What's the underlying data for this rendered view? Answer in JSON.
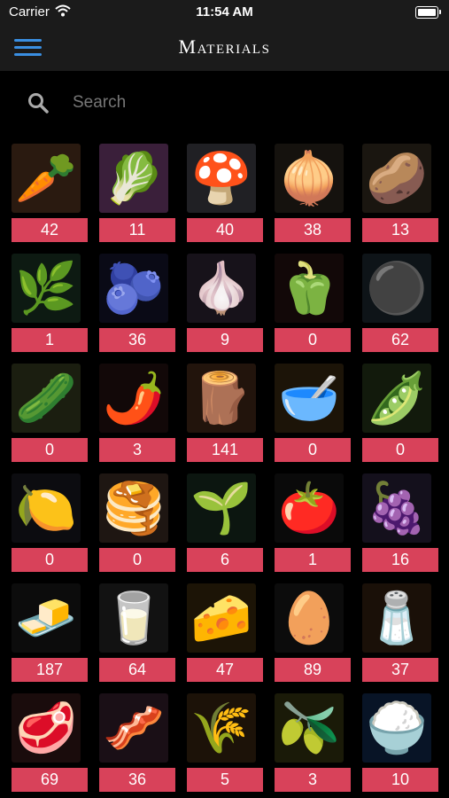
{
  "status_bar": {
    "carrier": "Carrier",
    "time": "11:54 AM"
  },
  "nav": {
    "title": "Materials"
  },
  "search": {
    "placeholder": "Search"
  },
  "materials": [
    {
      "icon": "carrot-icon",
      "glyph": "🥕",
      "bg": "#2a1a10",
      "count": "42"
    },
    {
      "icon": "lettuce-icon",
      "glyph": "🥬",
      "bg": "#3a1f3a",
      "count": "11"
    },
    {
      "icon": "mushroom-icon",
      "glyph": "🍄",
      "bg": "#202024",
      "count": "40"
    },
    {
      "icon": "onion-icon",
      "glyph": "🧅",
      "bg": "#15120e",
      "count": "38"
    },
    {
      "icon": "potato-icon",
      "glyph": "🥔",
      "bg": "#1a1610",
      "count": "13"
    },
    {
      "icon": "parsley-icon",
      "glyph": "🌿",
      "bg": "#0d1a12",
      "count": "1"
    },
    {
      "icon": "blueberries-icon",
      "glyph": "🫐",
      "bg": "#0a0a16",
      "count": "36"
    },
    {
      "icon": "garlic-icon",
      "glyph": "🧄",
      "bg": "#17121a",
      "count": "9"
    },
    {
      "icon": "bell-pepper-icon",
      "glyph": "🫑",
      "bg": "#120808",
      "count": "0"
    },
    {
      "icon": "peppercorns-icon",
      "glyph": "⚫",
      "bg": "#0e1418",
      "count": "62"
    },
    {
      "icon": "celery-icon",
      "glyph": "🥒",
      "bg": "#1b1e10",
      "count": "0"
    },
    {
      "icon": "chili-icon",
      "glyph": "🌶️",
      "bg": "#120808",
      "count": "3"
    },
    {
      "icon": "cinnamon-icon",
      "glyph": "🪵",
      "bg": "#22140c",
      "count": "141"
    },
    {
      "icon": "flour-bowl-icon",
      "glyph": "🥣",
      "bg": "#1c1408",
      "count": "0"
    },
    {
      "icon": "green-beans-icon",
      "glyph": "🫛",
      "bg": "#121a0c",
      "count": "0"
    },
    {
      "icon": "lemon-icon",
      "glyph": "🍋",
      "bg": "#0c0c10",
      "count": "0"
    },
    {
      "icon": "paprika-icon",
      "glyph": "🥞",
      "bg": "#1e1612",
      "count": "0"
    },
    {
      "icon": "basil-icon",
      "glyph": "🌱",
      "bg": "#0c1610",
      "count": "6"
    },
    {
      "icon": "tomato-icon",
      "glyph": "🍅",
      "bg": "#0a0a0a",
      "count": "1"
    },
    {
      "icon": "blackberries-icon",
      "glyph": "🍇",
      "bg": "#14101c",
      "count": "16"
    },
    {
      "icon": "butter-icon",
      "glyph": "🧈",
      "bg": "#0c0c0c",
      "count": "187"
    },
    {
      "icon": "milk-icon",
      "glyph": "🥛",
      "bg": "#121212",
      "count": "64"
    },
    {
      "icon": "cheese-icon",
      "glyph": "🧀",
      "bg": "#1c1406",
      "count": "47"
    },
    {
      "icon": "egg-icon",
      "glyph": "🥚",
      "bg": "#0c0c0c",
      "count": "89"
    },
    {
      "icon": "salt-icon",
      "glyph": "🧂",
      "bg": "#1a1008",
      "count": "37"
    },
    {
      "icon": "beef-icon",
      "glyph": "🥩",
      "bg": "#1a0c0c",
      "count": "69"
    },
    {
      "icon": "bacon-icon",
      "glyph": "🥓",
      "bg": "#1a0f16",
      "count": "36"
    },
    {
      "icon": "flour-sack-icon",
      "glyph": "🌾",
      "bg": "#1c1208",
      "count": "5"
    },
    {
      "icon": "oil-bottle-icon",
      "glyph": "🫒",
      "bg": "#1a1a08",
      "count": "3"
    },
    {
      "icon": "rice-pot-icon",
      "glyph": "🍚",
      "bg": "#081426",
      "count": "10"
    }
  ]
}
